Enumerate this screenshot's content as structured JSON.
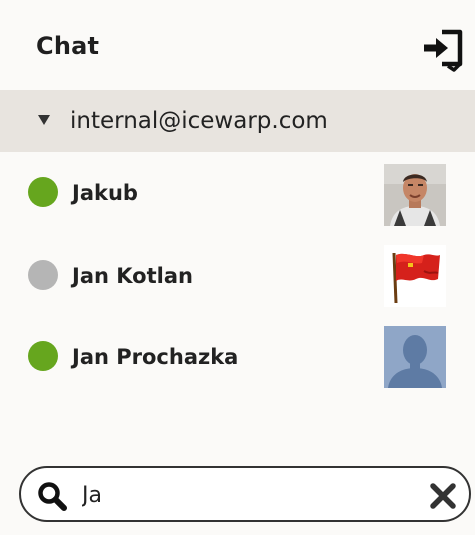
{
  "header": {
    "title": "Chat"
  },
  "group": {
    "label": "internal@icewarp.com",
    "expanded": true
  },
  "contacts": [
    {
      "name": "Jakub",
      "status": "online",
      "status_color": "#66a61e",
      "avatar": "photo-avatar-icon"
    },
    {
      "name": "Jan Kotlan",
      "status": "offline",
      "status_color": "#b5b5b5",
      "avatar": "red-flag-avatar-icon"
    },
    {
      "name": "Jan Prochazka",
      "status": "online",
      "status_color": "#66a61e",
      "avatar": "default-person-avatar-icon"
    }
  ],
  "search": {
    "value": "Ja"
  },
  "colors": {
    "panel_bg": "#fbfaf8",
    "group_bg": "#e8e4df",
    "online": "#66a61e",
    "offline": "#b5b5b5"
  }
}
